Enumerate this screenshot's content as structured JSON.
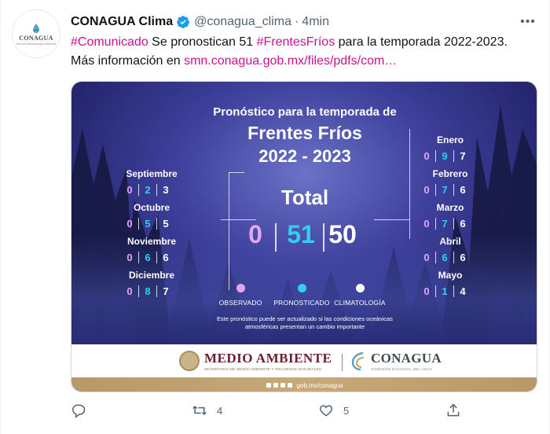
{
  "tweet": {
    "author_name": "CONAGUA Clima",
    "handle": "@conagua_clima",
    "separator": "·",
    "time": "4min",
    "avatar": {
      "name": "CONAGUA",
      "subtitle": "Servicio Meteorológico Nacional"
    },
    "text": {
      "hashtag1": "#Comunicado",
      "part1": " Se pronostican 51 ",
      "hashtag2": "#FrentesFríos",
      "part2": " para la temporada 2022-2023. Más información en ",
      "link": "smn.conagua.gob.mx/files/pdfs/com…"
    }
  },
  "media": {
    "subtitle": "Pronóstico para la temporada de",
    "title": "Frentes Fríos",
    "years": "2022 - 2023",
    "total_label": "Total",
    "total": {
      "observado": "0",
      "pronosticado": "51",
      "climatologia": "50"
    },
    "months_left": [
      {
        "name": "Septiembre",
        "o": "0",
        "p": "2",
        "c": "3"
      },
      {
        "name": "Octubre",
        "o": "0",
        "p": "5",
        "c": "5"
      },
      {
        "name": "Noviembre",
        "o": "0",
        "p": "6",
        "c": "6"
      },
      {
        "name": "Diciembre",
        "o": "0",
        "p": "8",
        "c": "7"
      }
    ],
    "months_right": [
      {
        "name": "Enero",
        "o": "0",
        "p": "9",
        "c": "7"
      },
      {
        "name": "Febrero",
        "o": "0",
        "p": "7",
        "c": "6"
      },
      {
        "name": "Marzo",
        "o": "0",
        "p": "7",
        "c": "6"
      },
      {
        "name": "Abril",
        "o": "0",
        "p": "6",
        "c": "6"
      },
      {
        "name": "Mayo",
        "o": "0",
        "p": "1",
        "c": "4"
      }
    ],
    "legend": [
      {
        "label": "OBSERVADO",
        "color": "#e4a6f5"
      },
      {
        "label": "PRONOSTICADO",
        "color": "#2fd0ee"
      },
      {
        "label": "CLIMATOLOGÍA",
        "color": "#ffffff"
      }
    ],
    "note_line1": "Este pronóstico puede ser actualizado si las condiciones oceánicas",
    "note_line2": "atmosféricas presentan un cambio importante",
    "footer": {
      "ma_title": "MEDIO AMBIENTE",
      "ma_sub": "SECRETARÍA DE MEDIO AMBIENTE Y RECURSOS NATURALES",
      "cg_title": "CONAGUA",
      "cg_sub": "COMISIÓN NACIONAL DEL AGUA",
      "url": "gob.mx/conagua"
    }
  },
  "actions": {
    "reply_count": "",
    "retweet_count": "4",
    "like_count": "5"
  },
  "colors": {
    "hashtag_link": "#c7148e",
    "verified": "#1d9bf0",
    "observado": "#e4a6f5",
    "pronosticado": "#2fd0ee"
  }
}
